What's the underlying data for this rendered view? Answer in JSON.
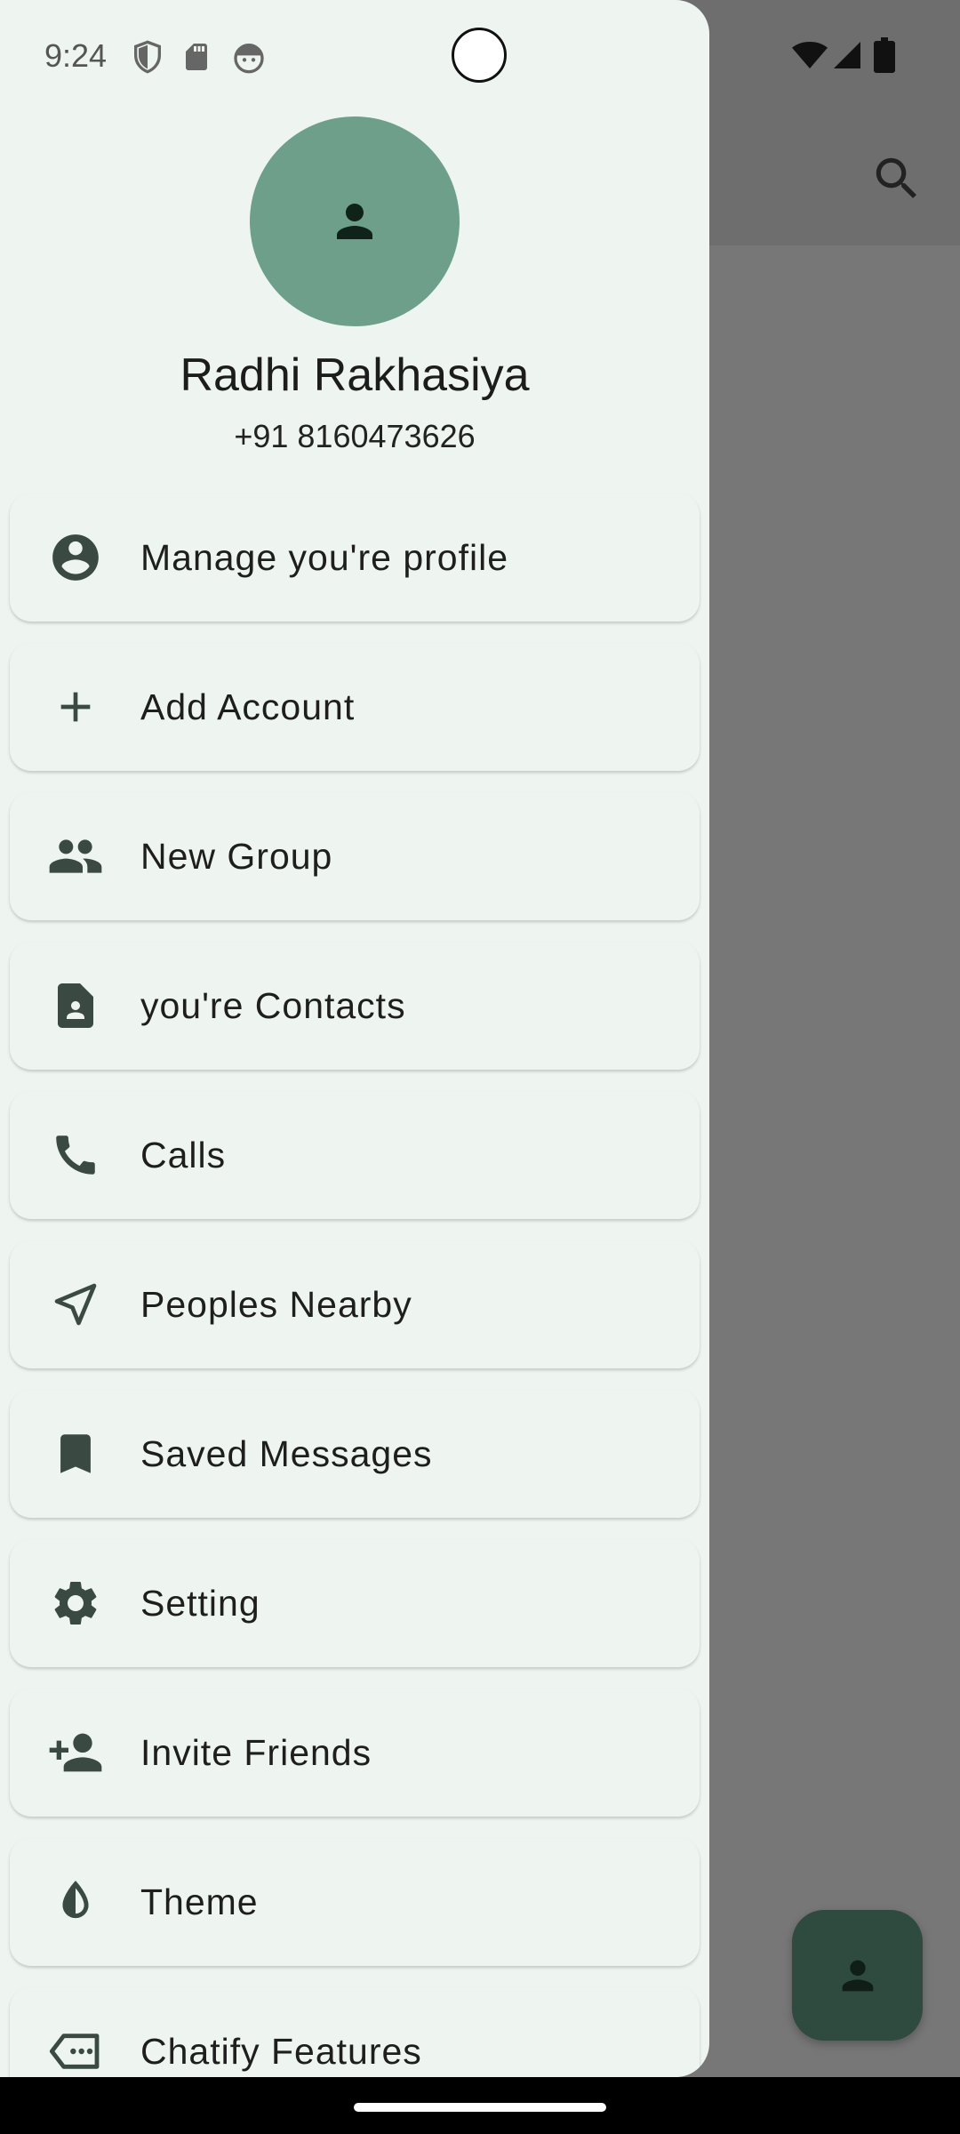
{
  "status_bar": {
    "time": "9:24"
  },
  "profile": {
    "name": "Radhi Rakhasiya",
    "phone": "+91 8160473626"
  },
  "menu": [
    {
      "label": "Manage you're profile",
      "icon": "account-circle-icon"
    },
    {
      "label": "Add Account",
      "icon": "plus-icon"
    },
    {
      "label": "New Group",
      "icon": "group-icon"
    },
    {
      "label": "you're Contacts",
      "icon": "contact-card-icon"
    },
    {
      "label": "Calls",
      "icon": "phone-icon"
    },
    {
      "label": "Peoples Nearby",
      "icon": "navigation-arrow-icon"
    },
    {
      "label": "Saved Messages",
      "icon": "bookmark-icon"
    },
    {
      "label": "Setting",
      "icon": "gear-icon"
    },
    {
      "label": "Invite Friends",
      "icon": "person-add-icon"
    },
    {
      "label": "Theme",
      "icon": "theme-drop-icon"
    },
    {
      "label": "Chatify Features",
      "icon": "label-dots-icon"
    }
  ],
  "colors": {
    "drawer_bg": "#eef4f0",
    "avatar_bg": "#6d9f8a",
    "fab_bg": "#2f4a3f",
    "scrim": "#777777"
  }
}
